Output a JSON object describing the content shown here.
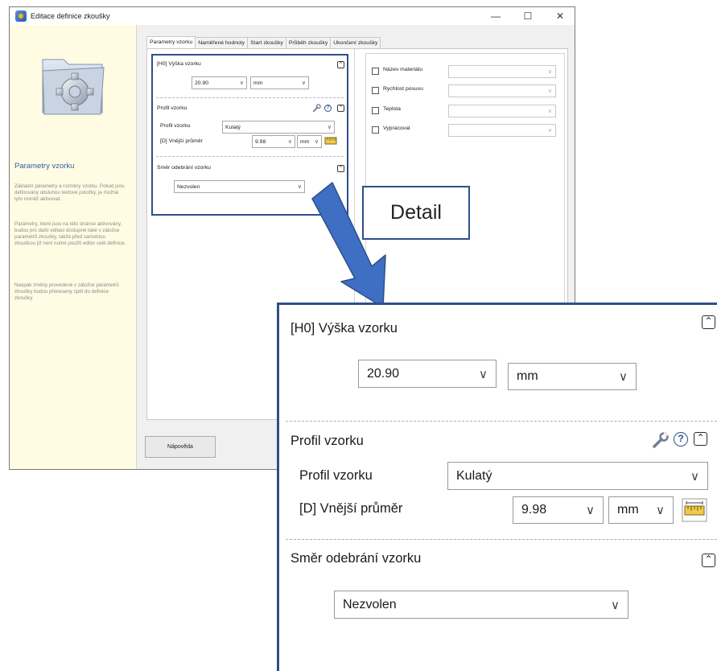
{
  "window": {
    "title": "Editace definice zkoušky",
    "minimize": "—",
    "maximize": "☐",
    "close": "✕"
  },
  "sidebar": {
    "icon": "folder-gear-icon",
    "title": "Parametry vzorku",
    "paragraphs": [
      "Základní parametry a rozměry vzorku. Pokud jsou definovány obsluhou textové položky, je možné tyto rovněž aktivovat.",
      "Parametry, které jsou na této stránce aktivovány, budou pro další editaci dostupné také v záložce parametrů zkoušky, takže před samotnou zkouškou již není nutné použít editor celé definice.",
      "Naopak změny provedené v záložce parametrů zkoušky budou přeneseny zpět do definice zkoušky."
    ]
  },
  "tabs": [
    "Parametry vzorku",
    "Naměřené hodnoty",
    "Start zkoušky",
    "Průběh zkoušky",
    "Ukončení zkoušky"
  ],
  "sections": {
    "height": {
      "label": "[H0]  Výška vzorku",
      "value": "20.90",
      "unit": "mm",
      "collapse": "⌃"
    },
    "profile": {
      "title": "Profil vzorku",
      "field_label": "Profil vzorku",
      "field_value": "Kulatý",
      "diameter_label": "[D]  Vnější průměr",
      "diameter_value": "9.98",
      "diameter_unit": "mm",
      "help": "?",
      "collapse": "⌃"
    },
    "direction": {
      "title": "Směr odebrání vzorku",
      "value": "Nezvolen",
      "collapse": "⌃"
    }
  },
  "right_fields": [
    {
      "label": "Název materiálu"
    },
    {
      "label": "Rychlost posuvu"
    },
    {
      "label": "Teplota"
    },
    {
      "label": "Vypracoval"
    }
  ],
  "help_button": "Nápověda",
  "detail_label": "Detail",
  "colors": {
    "callout_border": "#2e4f8c",
    "sidebar_bg": "#fffce3",
    "sidebar_title": "#2d5ea8",
    "arrow": "#3f6fc2"
  }
}
